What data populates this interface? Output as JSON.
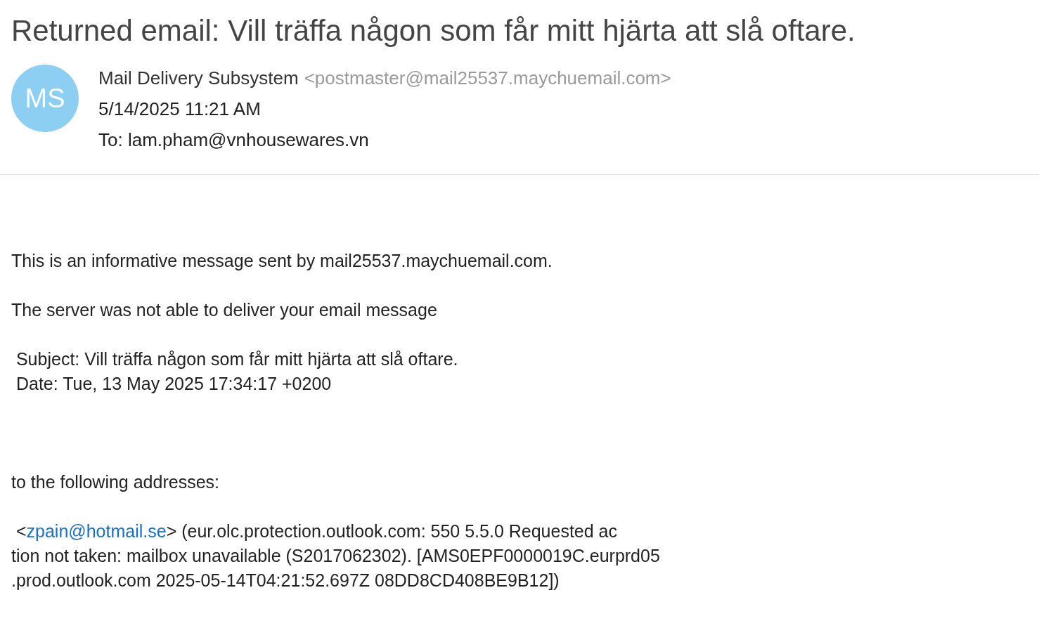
{
  "subject": "Returned email: Vill träffa någon som får mitt hjärta att slå oftare.",
  "sender": {
    "initials": "MS",
    "name": "Mail Delivery Subsystem",
    "address": "<postmaster@mail25537.maychuemail.com>",
    "date": "5/14/2025 11:21 AM",
    "to": "To: lam.pham@vnhousewares.vn"
  },
  "body": [
    {
      "kind": "text",
      "text": "This is an informative message sent by mail25537.maychuemail.com."
    },
    {
      "kind": "text",
      "text": "The server was not able to deliver your email message"
    },
    {
      "kind": "headers",
      "text": " Subject: Vill träffa någon som får mitt hjärta att slå oftare.\n Date: Tue, 13 May 2025 17:34:17 +0200"
    },
    {
      "kind": "text",
      "text": "to the following addresses:"
    },
    {
      "kind": "link",
      "before": " <",
      "link": "zpain@hotmail.se",
      "after": "> (eur.olc.protection.outlook.com: 550 5.5.0 Requested ac\ntion not taken: mailbox unavailable (S2017062302). [AMS0EPF0000019C.eurprd05\n.prod.outlook.com 2025-05-14T04:21:52.697Z 08DD8CD408BE9B12])"
    }
  ]
}
